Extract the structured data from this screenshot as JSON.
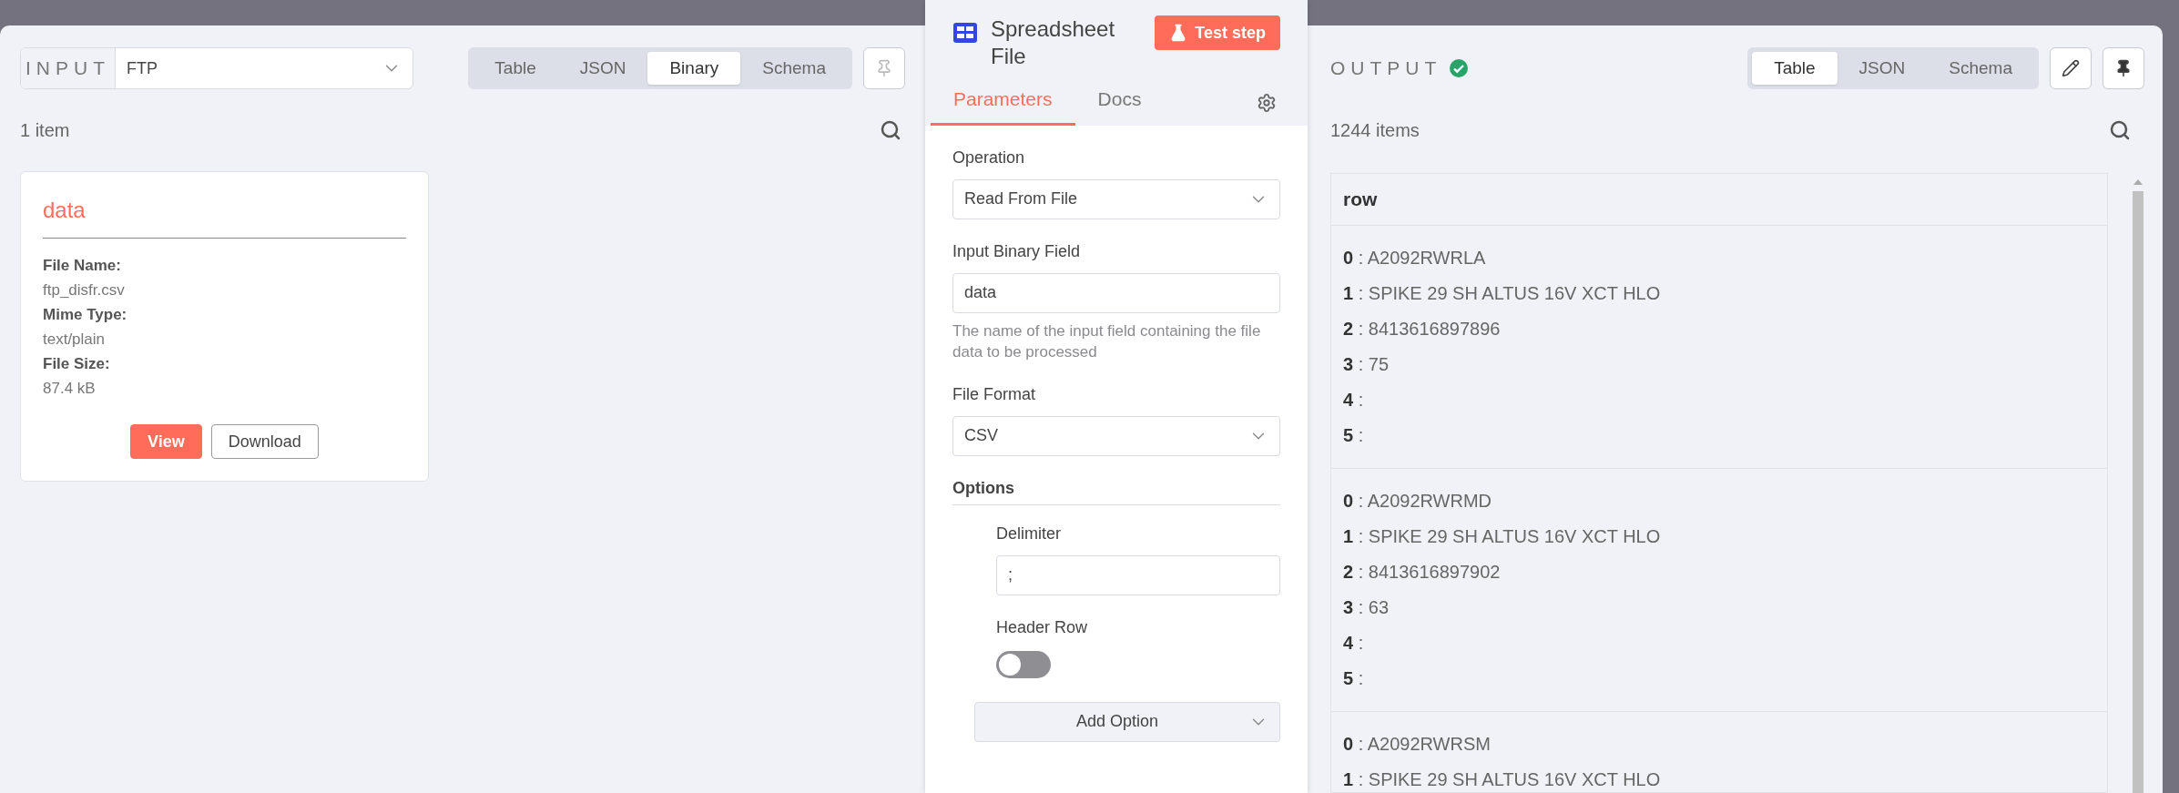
{
  "input": {
    "label": "INPUT",
    "source": "FTP",
    "view_tabs": [
      {
        "label": "Table",
        "selected": false
      },
      {
        "label": "JSON",
        "selected": false
      },
      {
        "label": "Binary",
        "selected": true
      },
      {
        "label": "Schema",
        "selected": false
      }
    ],
    "count": "1 item",
    "binary_card": {
      "title": "data",
      "fields": [
        {
          "label": "File Name:",
          "value": "ftp_disfr.csv"
        },
        {
          "label": "Mime Type:",
          "value": "text/plain"
        },
        {
          "label": "File Size:",
          "value": "87.4 kB"
        }
      ],
      "buttons": [
        {
          "label": "View",
          "kind": "primary"
        },
        {
          "label": "Download",
          "kind": "secondary"
        }
      ]
    }
  },
  "node": {
    "title": "Spreadsheet File",
    "test_button": "Test step",
    "tabs": [
      {
        "label": "Parameters",
        "selected": true
      },
      {
        "label": "Docs",
        "selected": false
      }
    ],
    "parameters": [
      {
        "kind": "select",
        "label": "Operation",
        "value": "Read From File"
      },
      {
        "kind": "text",
        "label": "Input Binary Field",
        "value": "data",
        "hint": "The name of the input field containing the file data to be processed"
      },
      {
        "kind": "select",
        "label": "File Format",
        "value": "CSV"
      }
    ],
    "options": {
      "title": "Options",
      "items": [
        {
          "kind": "text",
          "label": "Delimiter",
          "value": ";"
        },
        {
          "kind": "toggle",
          "label": "Header Row",
          "on": false
        }
      ],
      "add_button": "Add Option"
    }
  },
  "output": {
    "label": "OUTPUT",
    "success": true,
    "view_tabs": [
      {
        "label": "Table",
        "selected": true
      },
      {
        "label": "JSON",
        "selected": false
      },
      {
        "label": "Schema",
        "selected": false
      }
    ],
    "count": "1244 items",
    "table": {
      "columns": [
        "row"
      ],
      "rows": [
        [
          "**0** : A2092RWRLA",
          "**1** : SPIKE 29 SH ALTUS 16V XCT HLO",
          "**2** : 8413616897896",
          "**3** : 75",
          "**4** :",
          "**5** :"
        ],
        [
          "**0** : A2092RWRMD",
          "**1** : SPIKE 29 SH ALTUS 16V XCT HLO",
          "**2** : 8413616897902",
          "**3** : 63",
          "**4** :",
          "**5** :"
        ],
        [
          "**0** : A2092RWRSM",
          "**1** : SPIKE 29 SH ALTUS 16V XCT HLO"
        ]
      ]
    }
  }
}
